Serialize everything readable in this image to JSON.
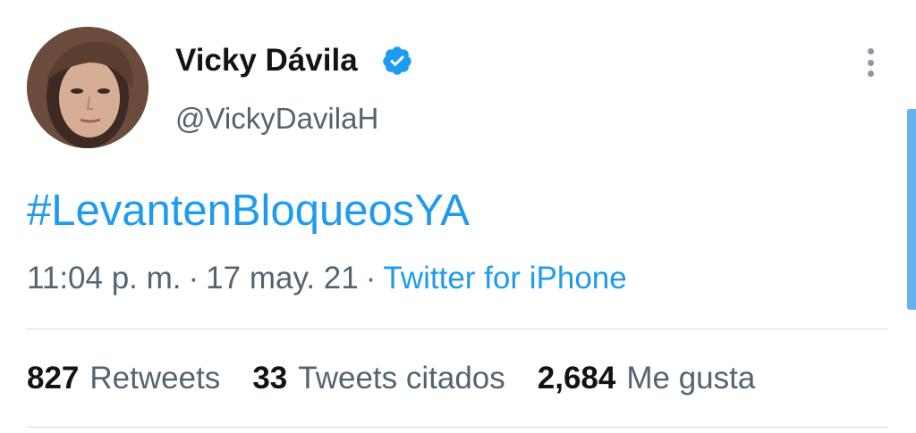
{
  "tweet": {
    "author": {
      "display_name": "Vicky Dávila",
      "handle": "@VickyDavilaH",
      "verified": true
    },
    "text": "#LevantenBloqueosYA",
    "time": "11:04 p. m.",
    "separator": "·",
    "date": "17 may. 21",
    "source": "Twitter for iPhone"
  },
  "stats": [
    {
      "count": "827",
      "label": "Retweets"
    },
    {
      "count": "33",
      "label": "Tweets citados"
    },
    {
      "count": "2,684",
      "label": "Me gusta"
    }
  ],
  "icons": {
    "verified": "verified-badge-icon",
    "more": "more-vertical-icon"
  },
  "colors": {
    "link": "#1d9bf0",
    "text": "#0f1419",
    "secondary": "#536471"
  }
}
